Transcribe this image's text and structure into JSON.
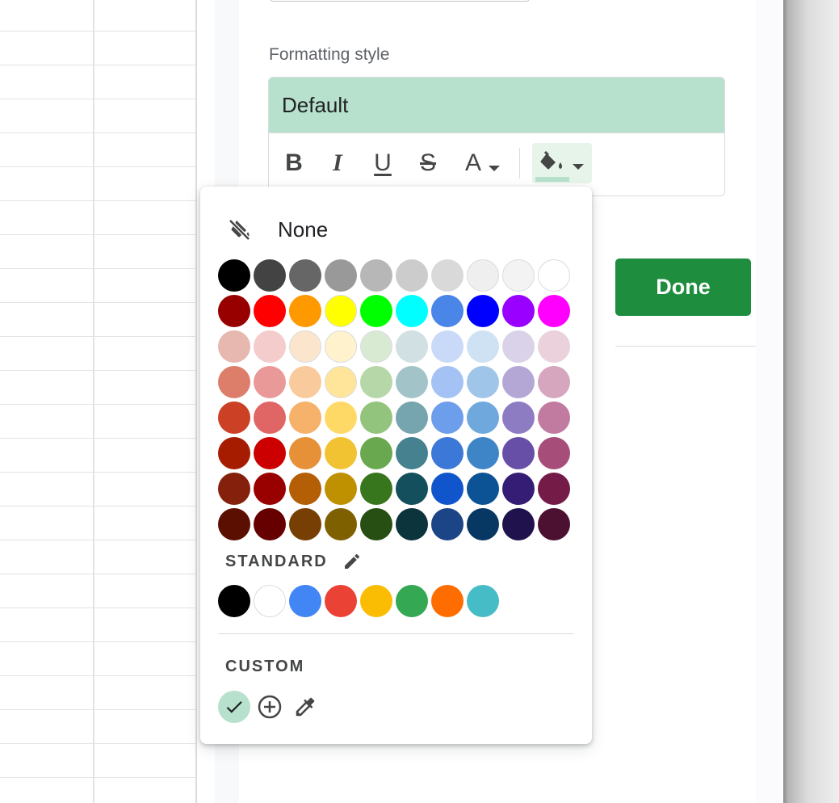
{
  "formatting": {
    "label": "Formatting style",
    "preview_text": "Default",
    "preview_color": "#b7e1cd",
    "toolbar": {
      "bold": "B",
      "italic": "I",
      "underline": "U",
      "strike": "S",
      "text_color": "A"
    }
  },
  "done_label": "Done",
  "popup": {
    "none_label": "None",
    "palette": [
      [
        "#000000",
        "#434343",
        "#666666",
        "#999999",
        "#b7b7b7",
        "#cccccc",
        "#d9d9d9",
        "#efefef",
        "#f3f3f3",
        "#ffffff"
      ],
      [
        "#980000",
        "#ff0000",
        "#ff9900",
        "#ffff00",
        "#00ff00",
        "#00ffff",
        "#4a86e8",
        "#0000ff",
        "#9900ff",
        "#ff00ff"
      ],
      [
        "#e6b8af",
        "#f4cccc",
        "#fce5cd",
        "#fff2cc",
        "#d9ead3",
        "#d0e0e3",
        "#c9daf8",
        "#cfe2f3",
        "#d9d2e9",
        "#ead1dc"
      ],
      [
        "#dd7e6b",
        "#ea9999",
        "#f9cb9c",
        "#ffe599",
        "#b6d7a8",
        "#a2c4c9",
        "#a4c2f4",
        "#9fc5e8",
        "#b4a7d6",
        "#d5a6bd"
      ],
      [
        "#cc4125",
        "#e06666",
        "#f6b26b",
        "#ffd966",
        "#93c47d",
        "#76a5af",
        "#6d9eeb",
        "#6fa8dc",
        "#8e7cc3",
        "#c27ba0"
      ],
      [
        "#a61c00",
        "#cc0000",
        "#e69138",
        "#f1c232",
        "#6aa84f",
        "#45818e",
        "#3c78d8",
        "#3d85c6",
        "#674ea7",
        "#a64d79"
      ],
      [
        "#85200c",
        "#990000",
        "#b45f06",
        "#bf9000",
        "#38761d",
        "#134f5c",
        "#1155cc",
        "#0b5394",
        "#351c75",
        "#741b47"
      ],
      [
        "#5b0f00",
        "#660000",
        "#783f04",
        "#7f6000",
        "#274e13",
        "#0c343d",
        "#1c4587",
        "#073763",
        "#20124d",
        "#4c1130"
      ]
    ],
    "standard_label": "STANDARD",
    "standard_colors": [
      "#000000",
      "#ffffff",
      "#4285f4",
      "#ea4335",
      "#fbbc04",
      "#34a853",
      "#ff6d01",
      "#46bdc6"
    ],
    "custom_label": "CUSTOM",
    "custom_colors": [
      "#b7e1cd"
    ]
  }
}
